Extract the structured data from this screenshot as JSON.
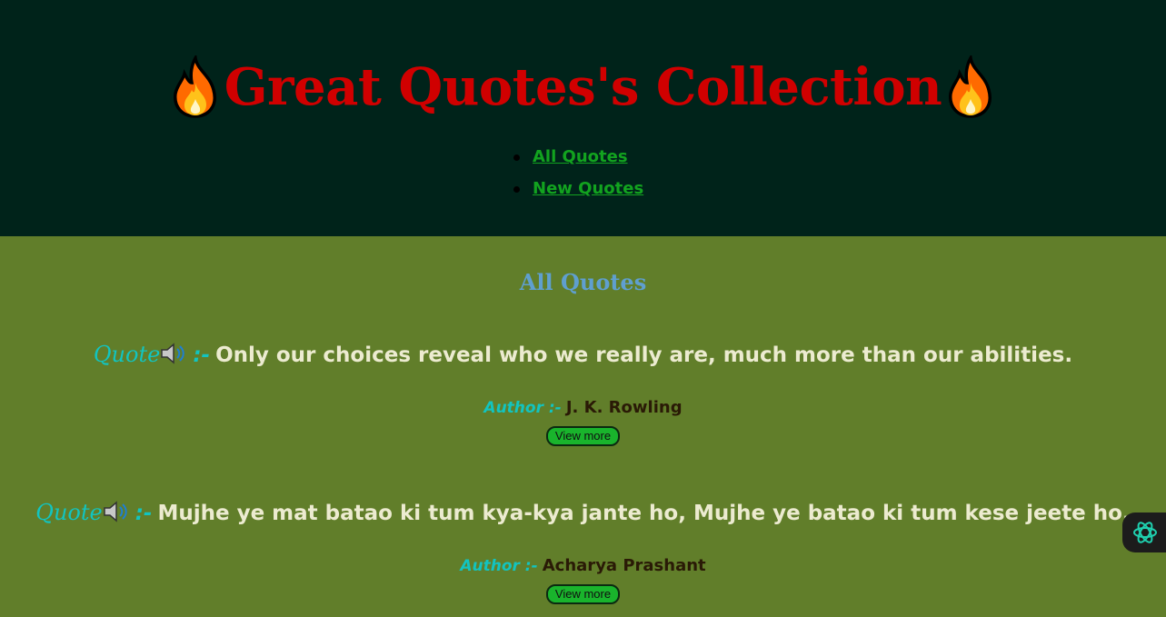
{
  "header": {
    "title": "Great Quotes's Collection",
    "left_icon": "fire-icon",
    "right_icon": "fire-icon",
    "nav": [
      {
        "label": "All Quotes"
      },
      {
        "label": "New Quotes"
      }
    ]
  },
  "main": {
    "section_title": "All Quotes",
    "quotes": [
      {
        "label": "Quote",
        "separator": ":-",
        "text": "Only our choices reveal who we really are, much more than our abilities.",
        "author_label": "Author :-",
        "author": "J. K. Rowling",
        "button": "View more"
      },
      {
        "label": "Quote",
        "separator": ":-",
        "text": "Mujhe ye mat batao ki tum kya-kya jante ho, Mujhe ye batao ki tum kese jeete ho.",
        "author_label": "Author :-",
        "author": "Acharya Prashant",
        "button": "View more"
      }
    ]
  },
  "colors": {
    "header_bg": "#00231a",
    "main_bg": "#617e2a",
    "title": "#d00000",
    "nav_link": "#12a31f",
    "section_title": "#5f9fcf",
    "label_accent": "#12c4c0",
    "quote_text": "#ecebd0",
    "author_text": "#2a1a06",
    "button_bg": "#19b42c"
  },
  "icons": {
    "speaker": "speaker-icon",
    "assistant": "assistant-icon"
  }
}
